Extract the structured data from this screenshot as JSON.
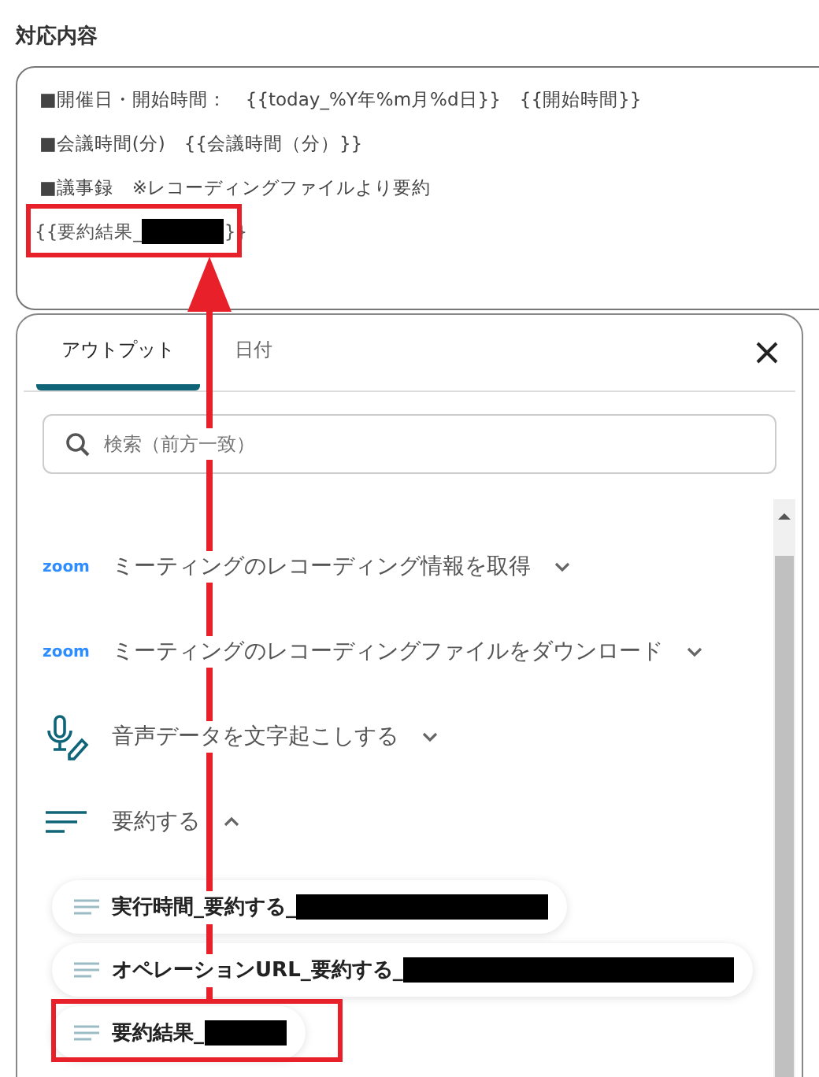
{
  "field": {
    "label": "対応内容",
    "lines": [
      {
        "parts": [
          "■開催日・開始時間：",
          "{{today_%Y年%m月%d日}}",
          "{{開始時間}}"
        ]
      },
      {
        "parts": [
          "■会議時間(分)",
          "{{会議時間（分）}}"
        ]
      },
      {
        "parts": [
          "■議事録",
          "※レコーディングファイルより要約"
        ]
      }
    ],
    "token": {
      "text": "{{要約結果_",
      "redacted": true,
      "suffix": "}}"
    }
  },
  "panel": {
    "tabs": [
      {
        "label": "アウトプット",
        "selected": true
      },
      {
        "label": "日付",
        "selected": false
      }
    ],
    "search": {
      "placeholder": "検索（前方一致）"
    },
    "groups": [
      {
        "kind": "zoom",
        "logo": "zoom",
        "label": "ミーティングのレコーディング情報を取得",
        "expanded": false
      },
      {
        "kind": "zoom",
        "logo": "zoom",
        "label": "ミーティングのレコーディングファイルをダウンロード",
        "expanded": false
      },
      {
        "kind": "mic",
        "label": "音声データを文字起こしする",
        "expanded": false
      },
      {
        "kind": "lines",
        "label": "要約する",
        "expanded": true,
        "children": [
          {
            "label": "実行時間_要約する_",
            "redacted": true
          },
          {
            "label": "オペレーションURL_要約する_",
            "redacted": true
          },
          {
            "label": "要約結果_",
            "redacted": true
          }
        ]
      }
    ]
  }
}
